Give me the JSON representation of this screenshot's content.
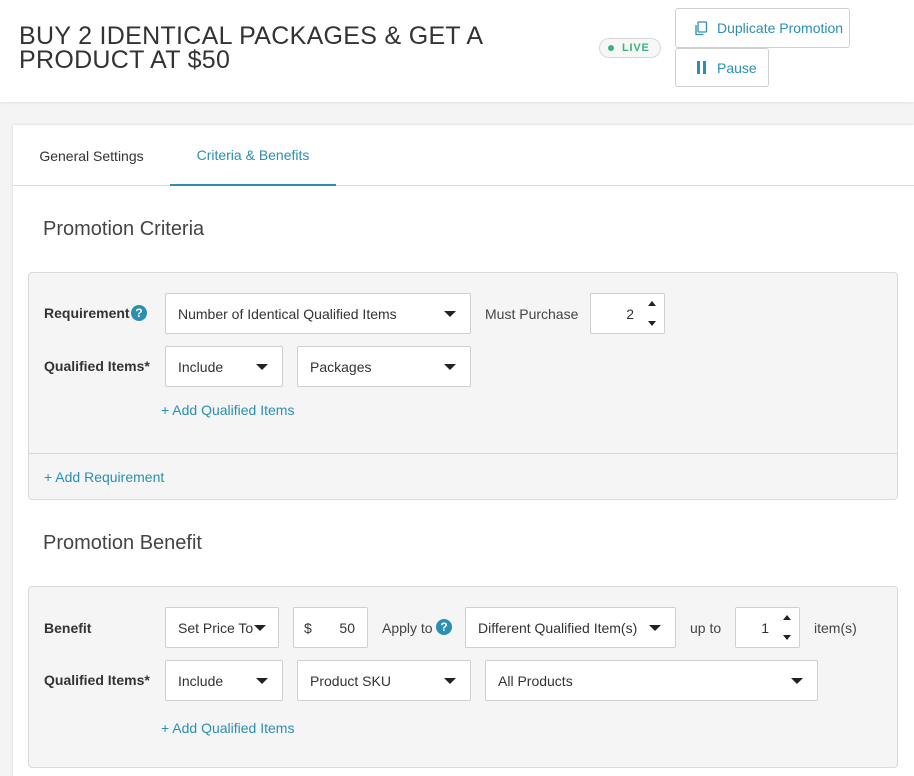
{
  "header": {
    "title": "BUY 2 IDENTICAL PACKAGES & GET A PRODUCT AT $50",
    "status_badge": "LIVE",
    "duplicate_label": "Duplicate Promotion",
    "pause_label": "Pause"
  },
  "tabs": [
    {
      "label": "General Settings",
      "active": false
    },
    {
      "label": "Criteria & Benefits",
      "active": true
    }
  ],
  "criteria": {
    "title": "Promotion Criteria",
    "requirement_label": "Requirement",
    "requirement_value": "Number of Identical Qualified Items",
    "must_purchase_label": "Must Purchase",
    "must_purchase_value": "2",
    "qualified_items_label": "Qualified Items*",
    "qualified_mode": "Include",
    "qualified_type": "Packages",
    "add_qualified_link": "+ Add Qualified Items",
    "add_requirement_link": "+ Add Requirement"
  },
  "benefit": {
    "title": "Promotion Benefit",
    "benefit_label": "Benefit",
    "benefit_type": "Set Price To",
    "currency": "$",
    "price": "50",
    "apply_to_label": "Apply to",
    "apply_to_value": "Different Qualified Item(s)",
    "up_to_label": "up to",
    "up_to_value": "1",
    "items_unit": "item(s)",
    "qualified_items_label": "Qualified Items*",
    "qualified_mode": "Include",
    "qualified_type": "Product SKU",
    "qualified_scope": "All Products",
    "add_qualified_link": "+ Add Qualified Items"
  },
  "colors": {
    "accent": "#2a8fb0",
    "live": "#3ab37a"
  }
}
